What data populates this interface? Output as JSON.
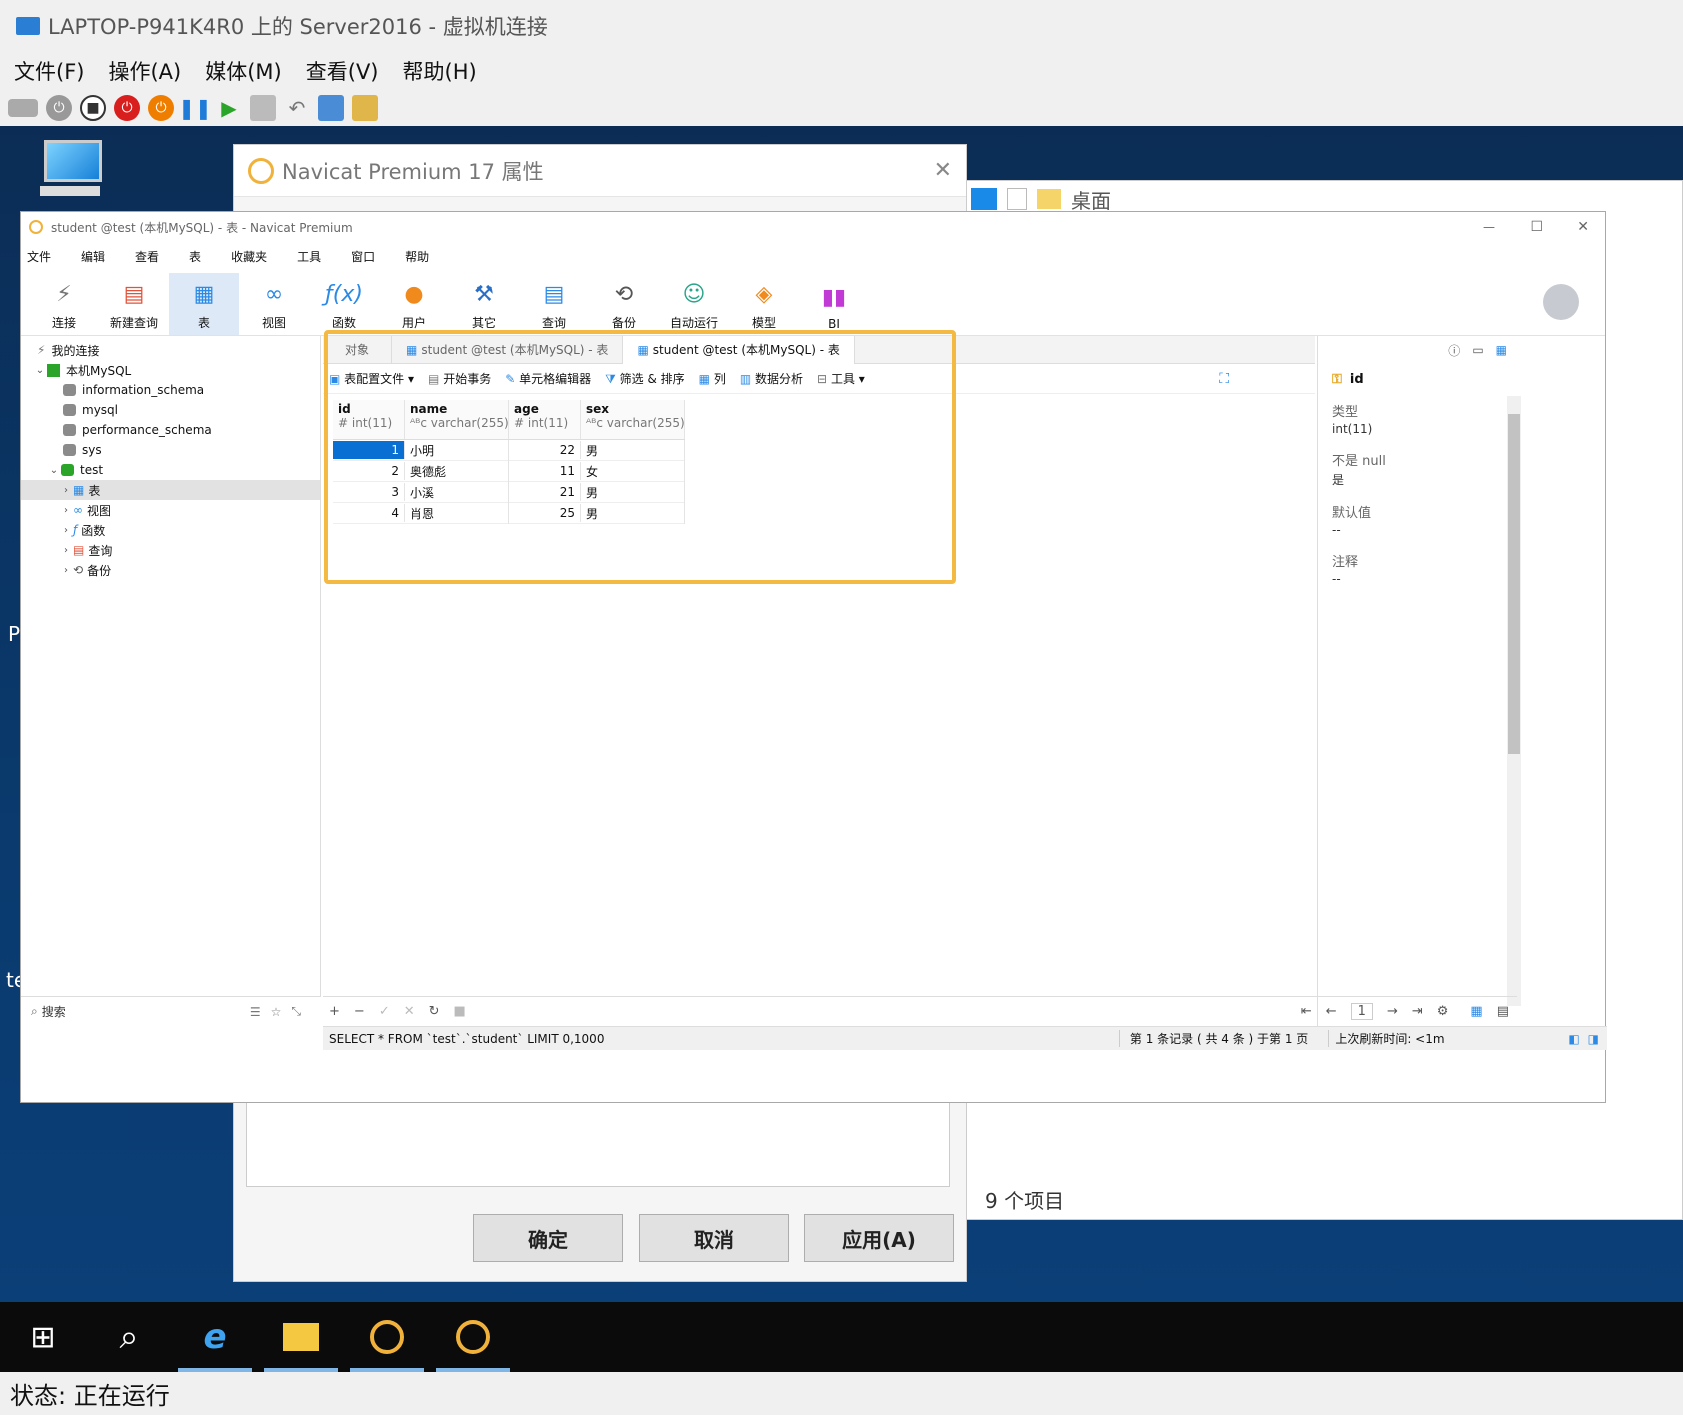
{
  "vm": {
    "title": "LAPTOP-P941K4R0 上的 Server2016 - 虚拟机连接",
    "menu": [
      "文件(F)",
      "操作(A)",
      "媒体(M)",
      "查看(V)",
      "帮助(H)"
    ],
    "status": "状态: 正在运行",
    "accent": "#0b3f77"
  },
  "desktop": {
    "edge_labels": [
      "P",
      "te"
    ]
  },
  "props_dialog": {
    "title": "Navicat Premium 17 属性",
    "buttons": [
      "确定",
      "取消",
      "应用(A)"
    ]
  },
  "explorer": {
    "path": "桌面",
    "item_count": "9 个项目"
  },
  "navicat": {
    "title": "student @test (本机MySQL) - 表 - Navicat Premium",
    "menu": [
      "文件",
      "编辑",
      "查看",
      "表",
      "收藏夹",
      "工具",
      "窗口",
      "帮助"
    ],
    "toolbar": [
      {
        "label": "连接",
        "icon": "plug-icon"
      },
      {
        "label": "新建查询",
        "icon": "new-query-icon"
      },
      {
        "label": "表",
        "icon": "table-icon"
      },
      {
        "label": "视图",
        "icon": "view-icon"
      },
      {
        "label": "函数",
        "icon": "function-icon"
      },
      {
        "label": "用户",
        "icon": "user-icon"
      },
      {
        "label": "其它",
        "icon": "tools-icon"
      },
      {
        "label": "查询",
        "icon": "query-icon"
      },
      {
        "label": "备份",
        "icon": "backup-icon"
      },
      {
        "label": "自动运行",
        "icon": "robot-icon"
      },
      {
        "label": "模型",
        "icon": "model-icon"
      },
      {
        "label": "BI",
        "icon": "bi-icon"
      }
    ],
    "sidebar": {
      "root": "我的连接",
      "connection": "本机MySQL",
      "databases": [
        "information_schema",
        "mysql",
        "performance_schema",
        "sys",
        "test"
      ],
      "test_children": [
        "表",
        "视图",
        "函数",
        "查询",
        "备份"
      ],
      "search_placeholder": "搜索"
    },
    "tabs": [
      "对象",
      "student @test (本机MySQL) - 表",
      "student @test (本机MySQL) - 表"
    ],
    "grid_tools": [
      "表配置文件",
      "开始事务",
      "单元格编辑器",
      "筛选 & 排序",
      "列",
      "数据分析",
      "工具"
    ],
    "columns": [
      {
        "name": "id",
        "type": "int(11)",
        "type_icon": "#"
      },
      {
        "name": "name",
        "type": "varchar(255)",
        "type_icon": "ᴬᴮc"
      },
      {
        "name": "age",
        "type": "int(11)",
        "type_icon": "#"
      },
      {
        "name": "sex",
        "type": "varchar(255)",
        "type_icon": "ᴬᴮc"
      }
    ],
    "rows": [
      [
        "1",
        "小明",
        "22",
        "男"
      ],
      [
        "2",
        "奥德彪",
        "11",
        "女"
      ],
      [
        "3",
        "小溪",
        "21",
        "男"
      ],
      [
        "4",
        "肖恩",
        "25",
        "男"
      ]
    ],
    "page": "1",
    "sql": "SELECT * FROM `test`.`student` LIMIT 0,1000",
    "records": "第 1 条记录 ( 共 4 条 ) 于第 1 页",
    "refresh": "上次刷新时间: <1m",
    "info": {
      "field": "id",
      "type_label": "类型",
      "type_value": "int(11)",
      "notnull_label": "不是 null",
      "notnull_value": "是",
      "default_label": "默认值",
      "default_value": "--",
      "comment_label": "注释",
      "comment_value": "--"
    },
    "highlight_color": "#f4b942",
    "selection_color": "#0a6fd2"
  }
}
